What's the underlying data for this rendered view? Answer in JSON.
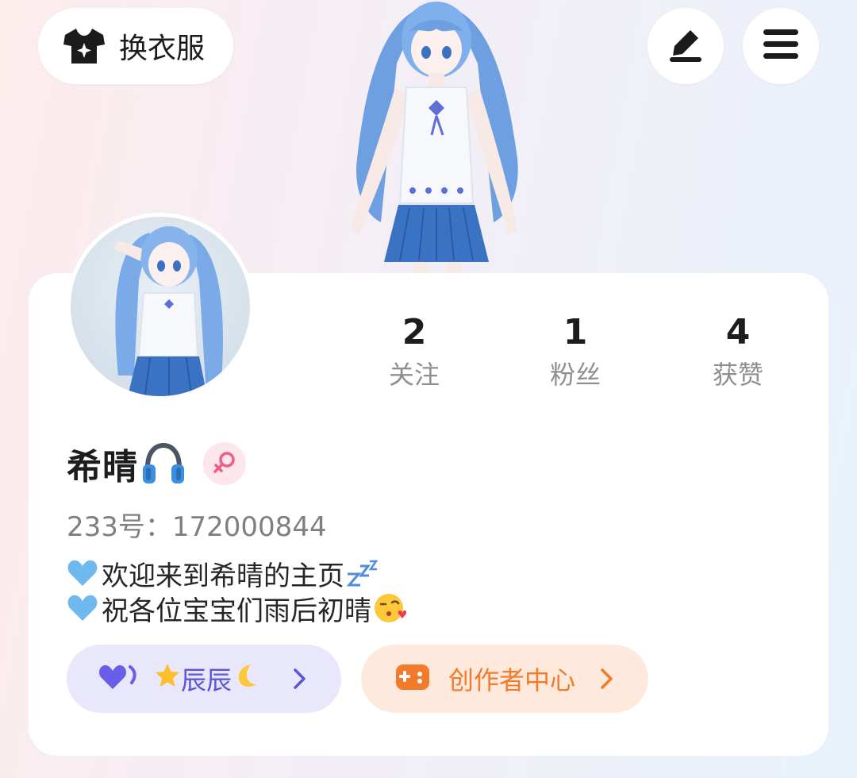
{
  "header": {
    "dress_label": "换衣服",
    "dress_icon": "tshirt-sparkle-icon",
    "edit_icon": "pen-icon",
    "menu_icon": "hamburger-menu-icon"
  },
  "stats": {
    "follow": {
      "value": "2",
      "label": "关注"
    },
    "fans": {
      "value": "1",
      "label": "粉丝"
    },
    "likes": {
      "value": "4",
      "label": "获赞"
    }
  },
  "profile": {
    "name": "希晴",
    "name_emoji": "headphones-icon",
    "gender": "female",
    "uid_text": "233号：172000844",
    "bio": [
      {
        "prefix": "blue-heart-icon",
        "text": "欢迎来到希晴的主页",
        "suffix": "zzz-icon"
      },
      {
        "prefix": "blue-heart-icon",
        "text": "祝各位宝宝们雨后初晴",
        "suffix": "kiss-face-icon"
      }
    ]
  },
  "buttons": {
    "club_label": "辰辰",
    "club_prefix": "star-icon",
    "club_suffix": "crescent-moon-icon",
    "creator_label": "创作者中心"
  },
  "colors": {
    "accent_purple": "#5b55d9",
    "accent_orange": "#f27a2b",
    "gender_pink": "#ef5e86",
    "heart_blue": "#6fb8f0"
  }
}
